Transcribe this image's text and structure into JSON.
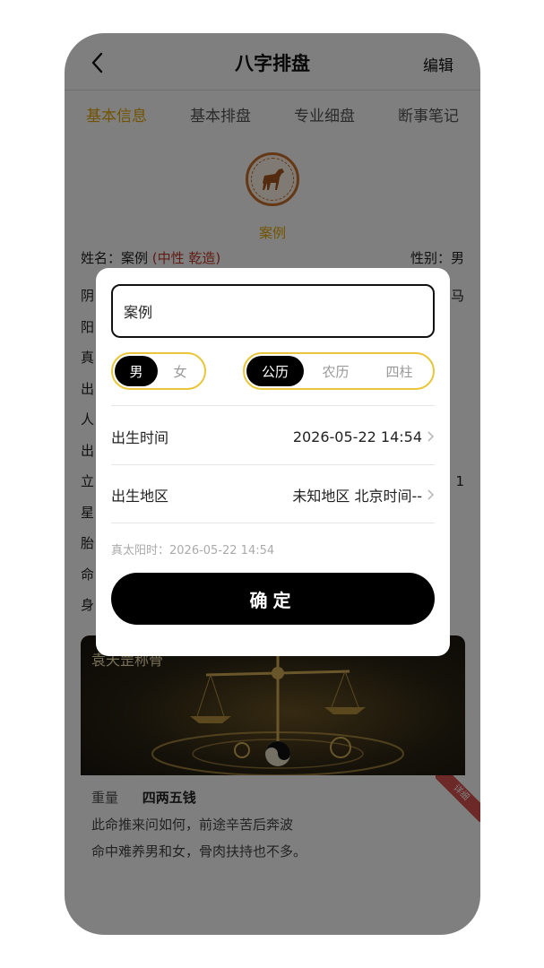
{
  "nav": {
    "title": "八字排盘",
    "edit_label": "编辑"
  },
  "tabs": [
    {
      "label": "基本信息",
      "active": true
    },
    {
      "label": "基本排盘",
      "active": false
    },
    {
      "label": "专业细盘",
      "active": false
    },
    {
      "label": "断事笔记",
      "active": false
    }
  ],
  "profile": {
    "display_name": "案例",
    "name_label": "姓名：案例",
    "name_tags": "(中性 乾造)",
    "gender_label": "性别：男",
    "left_row_chars": [
      "阴",
      "阳",
      "真",
      "出",
      "人",
      "出",
      "立",
      "星",
      "胎",
      "命",
      "身"
    ],
    "right_row_chars": [
      "马",
      "",
      "",
      "",
      "",
      "",
      "1"
    ]
  },
  "banner": {
    "title": "袁天罡称骨"
  },
  "weight": {
    "label": "重量",
    "value": "四两五钱",
    "poem_line1": "此命推来问如何，前途辛苦后奔波",
    "poem_line2": "命中难养男和女，骨肉扶持也不多。",
    "ribbon": "详细"
  },
  "dialog": {
    "name_value": "案例",
    "gender_options": [
      "男",
      "女"
    ],
    "gender_selected": "男",
    "calendar_options": [
      "公历",
      "农历",
      "四柱"
    ],
    "calendar_selected": "公历",
    "birth_time_label": "出生时间",
    "birth_time_value": "2026-05-22 14:54",
    "birth_place_label": "出生地区",
    "birth_place_value": "未知地区 北京时间--",
    "true_solar_time": "真太阳时：2026-05-22 14:54",
    "confirm_label": "确定"
  },
  "colors": {
    "accent": "#e4a700",
    "selected": "#000000",
    "seg_border": "#e8c63a",
    "tag_red": "#c0392b"
  }
}
